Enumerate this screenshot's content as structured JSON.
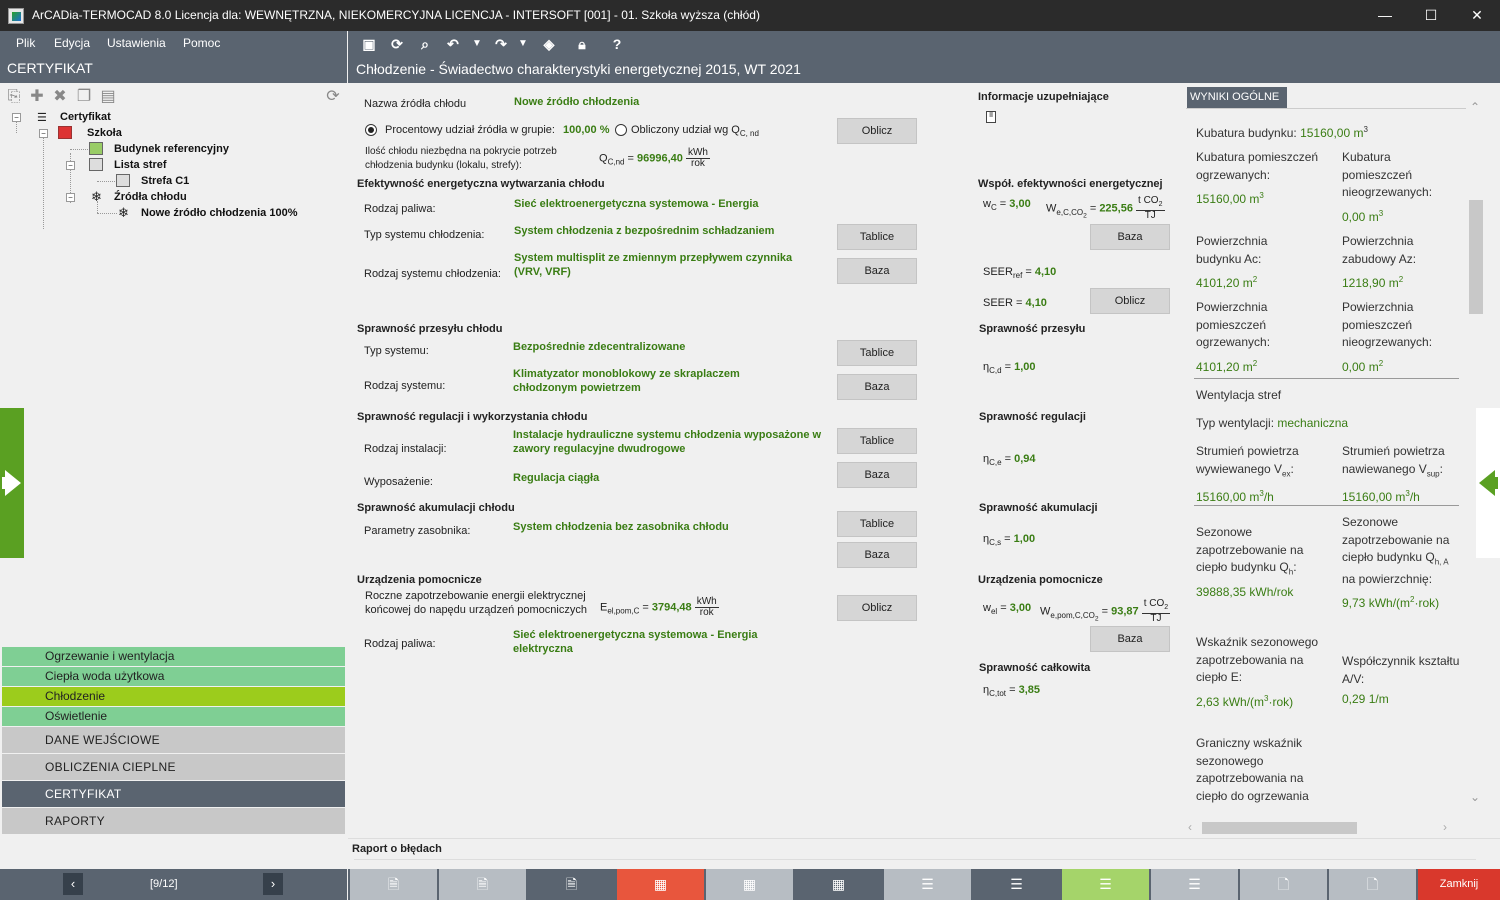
{
  "window": {
    "title": "ArCADia-TERMOCAD 8.0 Licencja dla: WEWNĘTRZNA, NIEKOMERCYJNA LICENCJA - INTERSOFT [001] - 01. Szkoła wyższa (chłód)",
    "minimize": "—",
    "maximize": "☐",
    "close": "✕"
  },
  "menu": {
    "file": "Plik",
    "edit": "Edycja",
    "settings": "Ustawienia",
    "help": "Pomoc"
  },
  "left": {
    "header": "CERTYFIKAT"
  },
  "tree": {
    "root": "Certyfikat",
    "school": "Szkoła",
    "ref_building": "Budynek referencyjny",
    "zones": "Lista stref",
    "zone1": "Strefa C1",
    "sources": "Źródła chłodu",
    "new_source": "Nowe źródło chłodzenia 100%"
  },
  "modules": [
    "Ogrzewanie i wentylacja",
    "Ciepła woda użytkowa",
    "Chłodzenie",
    "Oświetlenie"
  ],
  "nav": [
    "DANE WEJŚCIOWE",
    "OBLICZENIA CIEPLNE",
    "CERTYFIKAT",
    "RAPORTY"
  ],
  "pager": {
    "label": "[9/12]",
    "prev": "‹",
    "next": "›"
  },
  "page": {
    "title": "Chłodzenie - Świadectwo charakterystyki energetycznej 2015, WT 2021"
  },
  "form": {
    "source_name_label": "Nazwa źródła chłodu",
    "source_name": "Nowe źródło chłodzenia",
    "radio1_label": "Procentowy udział źródła w grupie:",
    "radio1_value": "100,00 %",
    "radio2_label": "Obliczony udział wg Q",
    "radio2_sub": "C, nd",
    "calc_btn": "Oblicz",
    "need_label1": "Ilość chłodu niezbędna na pokrycie potrzeb",
    "need_label2": "chłodzenia budynku (lokalu, strefy):",
    "need_sym": "Q",
    "need_sub": "C,nd",
    "need_value": "96996,40",
    "unit_kwh": "kWh",
    "unit_rok": "rok",
    "sec_gen": "Efektywność energetyczna wytwarzania chłodu",
    "fuel_label": "Rodzaj paliwa:",
    "fuel": "Sieć elektroenergetyczna systemowa - Energia",
    "sys_type_label": "Typ systemu chłodzenia:",
    "sys_type": "System chłodzenia z bezpośrednim schładzaniem",
    "sys_kind_label": "Rodzaj systemu chłodzenia:",
    "sys_kind": "System multisplit ze zmiennym przepływem czynnika (VRV, VRF)",
    "btn_tables": "Tablice",
    "btn_base": "Baza",
    "sec_trans": "Sprawność przesyłu chłodu",
    "trans_type_label": "Typ systemu:",
    "trans_type": "Bezpośrednie zdecentralizowane",
    "trans_kind_label": "Rodzaj systemu:",
    "trans_kind": "Klimatyzator monoblokowy ze skraplaczem chłodzonym powietrzem",
    "sec_reg": "Sprawność regulacji i wykorzystania chłodu",
    "inst_label": "Rodzaj instalacji:",
    "inst": "Instalacje hydrauliczne systemu chłodzenia wyposażone w zawory regulacyjne dwudrogowe",
    "equip_label": "Wyposażenie:",
    "equip": "Regulacja ciągła",
    "sec_acc": "Sprawność akumulacji chłodu",
    "tank_label": "Parametry zasobnika:",
    "tank": "System chłodzenia bez zasobnika chłodu",
    "sec_aux": "Urządzenia pomocnicze",
    "aux_label1": "Roczne zapotrzebowanie energii elektrycznej",
    "aux_label2": "końcowej do napędu urządzeń pomocniczych",
    "aux_sym": "E",
    "aux_sub": "el,pom,C",
    "aux_value": "3794,48",
    "aux_fuel_label": "Rodzaj paliwa:",
    "aux_fuel": "Sieć elektroenergetyczna systemowa - Energia elektryczna",
    "sec_info": "Informacje uzupełniające",
    "sec_coef": "Współ. efektywności energetycznej",
    "wc_sym": "w",
    "wc_sub": "C",
    "wc_val": "3,00",
    "we_sym": "W",
    "we_sub": "e,C,CO",
    "we_sub2": "2",
    "we_val": "225,56",
    "unit_tco2": "t CO",
    "unit_co2_sub": "2",
    "unit_tj": "TJ",
    "seer_ref_sym": "SEER",
    "seer_ref_sub": "ref",
    "seer_ref_val": "4,10",
    "seer_sym": "SEER",
    "seer_val": "4,10",
    "sec_trans_r": "Sprawność przesyłu",
    "eta_d_sym": "η",
    "eta_d_sub": "C,d",
    "eta_d_val": "1,00",
    "sec_reg_r": "Sprawność regulacji",
    "eta_e_sym": "η",
    "eta_e_sub": "C,e",
    "eta_e_val": "0,94",
    "sec_acc_r": "Sprawność akumulacji",
    "eta_s_sym": "η",
    "eta_s_sub": "C,s",
    "eta_s_val": "1,00",
    "sec_aux_r": "Urządzenia pomocnicze",
    "wel_sym": "w",
    "wel_sub": "el",
    "wel_val": "3,00",
    "wepom_sym": "W",
    "wepom_sub": "e,pom,C,CO",
    "wepom_sub2": "2",
    "wepom_val": "93,87",
    "sec_total": "Sprawność całkowita",
    "eta_tot_sym": "η",
    "eta_tot_sub": "C,tot",
    "eta_tot_val": "3,85"
  },
  "results": {
    "header": "WYNIKI OGÓLNE",
    "kub": "Kubatura budynku: ",
    "kub_v": "15160,00 m",
    "sup3": "3",
    "kub_ogr_l": "Kubatura pomieszczeń ogrzewanych:",
    "kub_ogr_v": "15160,00 m",
    "kub_nog_l": "Kubatura pomieszczeń nieogrzewanych:",
    "kub_nog_v": "0,00 m",
    "pow_ac_l": "Powierzchnia budynku Ac:",
    "pow_ac_v": "4101,20 m",
    "sup2": "2",
    "pow_az_l": "Powierzchnia zabudowy Az:",
    "pow_az_v": "1218,90 m",
    "pow_ogr_l": "Powierzchnia pomieszczeń ogrzewanych:",
    "pow_ogr_v": "4101,20 m",
    "pow_nog_l": "Powierzchnia pomieszczeń nieogrzewanych:",
    "pow_nog_v": "0,00 m",
    "went": "Wentylacja stref",
    "went_typ_l": "Typ wentylacji: ",
    "went_typ_v": "mechaniczna",
    "str_wyw_l": "Strumień powietrza wywiewanego V",
    "str_wyw_sub": "ex",
    "str_wyw_v": "15160,00 m",
    "str_naw_l": "Strumień powietrza nawiewanego V",
    "str_naw_sub": "sup",
    "str_naw_v": "15160,00 m",
    "unit_h": "/h",
    "sez_l": "Sezonowe zapotrzebowanie na ciepło budynku Q",
    "sez_sub": "h",
    "sez_v": "39888,35 kWh/rok",
    "sez2_l1": "Sezonowe zapotrzebowanie na ciepło budynku Q",
    "sez2_sub": "h, A",
    "sez2_l2": " na powierzchnię:",
    "sez2_v": "9,73 kWh/(m",
    "sez2_v2": "·rok)",
    "wsk_l": "Wskaźnik sezonowego zapotrzebowania na ciepło E:",
    "wsk_v": "2,63 kWh/(m",
    "wsk_v2": "·rok)",
    "ksz_l": "Współczynnik kształtu A/V:",
    "ksz_v": "0,29 1/m",
    "gr_l": "Graniczny wskaźnik sezonowego zapotrzebowania na ciepło do ogrzewania"
  },
  "errors": {
    "title": "Raport o błędach"
  },
  "bottom": {
    "close": "Zamknij"
  },
  "colors": {
    "accent_green": "#3a7d14",
    "module_green": "#7fcf94",
    "active_module": "#9ccc1c",
    "dark_gray": "#5a6470",
    "red": "#d9382c"
  }
}
